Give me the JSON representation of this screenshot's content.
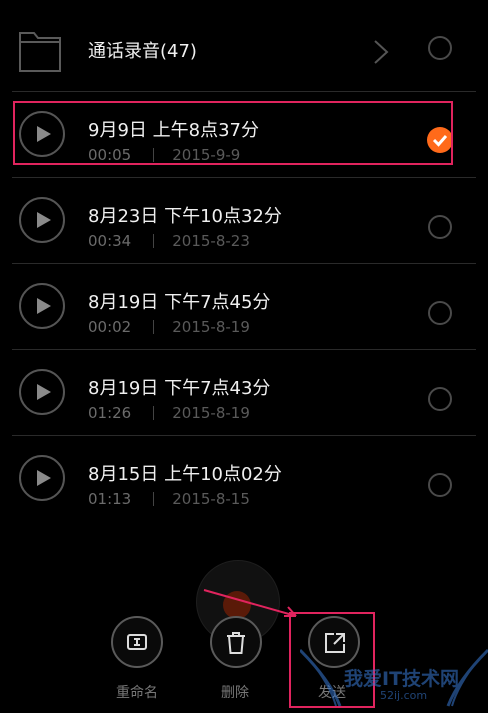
{
  "folder": {
    "name": "通话录音(47)",
    "icon": "folder-icon"
  },
  "recordings": [
    {
      "title": "9月9日 上午8点37分",
      "duration": "00:05",
      "date": "2015-9-9",
      "selected": true
    },
    {
      "title": "8月23日 下午10点32分",
      "duration": "00:34",
      "date": "2015-8-23",
      "selected": false
    },
    {
      "title": "8月19日 下午7点45分",
      "duration": "00:02",
      "date": "2015-8-19",
      "selected": false
    },
    {
      "title": "8月19日 下午7点43分",
      "duration": "01:26",
      "date": "2015-8-19",
      "selected": false
    },
    {
      "title": "8月15日 上午10点02分",
      "duration": "01:13",
      "date": "2015-8-15",
      "selected": false
    }
  ],
  "actions": {
    "rename": "重命名",
    "delete": "删除",
    "send": "发送"
  },
  "watermark": {
    "text": "我爱IT技术网",
    "url": "52ij.com"
  },
  "colors": {
    "accent": "#ff6a1a",
    "highlight": "#e0245e",
    "background": "#000000"
  }
}
